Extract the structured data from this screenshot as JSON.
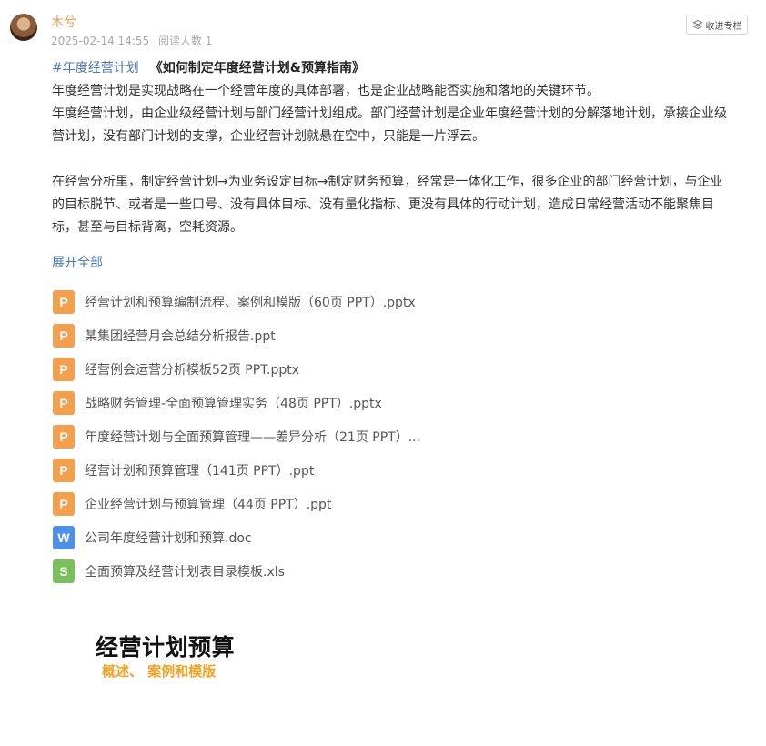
{
  "author": {
    "name": "木兮",
    "date": "2025-02-14 14:55",
    "read_count": "阅读人数 1"
  },
  "collect_button": {
    "label": "收进专栏",
    "icon": "layers-icon"
  },
  "article": {
    "hashtag": "#年度经营计划",
    "title": "《如何制定年度经营计划&预算指南》",
    "lines": [
      "年度经营计划是实现战略在一个经营年度的具体部署，也是企业战略能否实施和落地的关键环节。",
      "年度经营计划，由企业级经营计划与部门经营计划组成。部门经营计划是企业年度经营计划的分解落地计划，承接企业级",
      "营计划，没有部门计划的支撑，企业经营计划就悬在空中，只能是一片浮云。",
      "",
      "在经营分析里，制定经营计划→为业务设定目标→制定财务预算，经常是一体化工作，很多企业的部门经营计划，与企业",
      "的目标脱节、或者是一些口号、没有具体目标、没有量化指标、更没有具体的行动计划，造成日常经营活动不能聚焦目",
      "标，甚至与目标背离，空耗资源。"
    ],
    "expand_label": "展开全部"
  },
  "files": [
    {
      "type": "ppt",
      "icon": "ppt-file-icon",
      "glyph": "P",
      "name": "经营计划和预算编制流程、案例和模版（60页 PPT）.pptx"
    },
    {
      "type": "ppt",
      "icon": "ppt-file-icon",
      "glyph": "P",
      "name": "某集团经营月会总结分析报告.ppt"
    },
    {
      "type": "ppt",
      "icon": "ppt-file-icon",
      "glyph": "P",
      "name": "经营例会运营分析模板52页 PPT.pptx"
    },
    {
      "type": "ppt",
      "icon": "ppt-file-icon",
      "glyph": "P",
      "name": "战略财务管理-全面预算管理实务（48页 PPT）.pptx"
    },
    {
      "type": "ppt",
      "icon": "ppt-file-icon",
      "glyph": "P",
      "name": "年度经营计划与全面预算管理——差异分析（21页 PPT）..."
    },
    {
      "type": "ppt",
      "icon": "ppt-file-icon",
      "glyph": "P",
      "name": "经营计划和预算管理（141页 PPT）.ppt"
    },
    {
      "type": "ppt",
      "icon": "ppt-file-icon",
      "glyph": "P",
      "name": "企业经营计划与预算管理（44页 PPT）.ppt"
    },
    {
      "type": "doc",
      "icon": "word-file-icon",
      "glyph": "W",
      "name": "公司年度经营计划和预算.doc"
    },
    {
      "type": "xls",
      "icon": "excel-file-icon",
      "glyph": "S",
      "name": "全面预算及经营计划表目录模板.xls"
    }
  ],
  "cover_image": {
    "title": "经营计划预算",
    "subtitle": "概述、 案例和模版"
  },
  "colors": {
    "author": "#e8a24e",
    "link": "#4a78b0",
    "ppt": "#f2a04d",
    "doc": "#4e8fe8",
    "xls": "#7ac05a",
    "cover_subtitle": "#f2a21e"
  }
}
